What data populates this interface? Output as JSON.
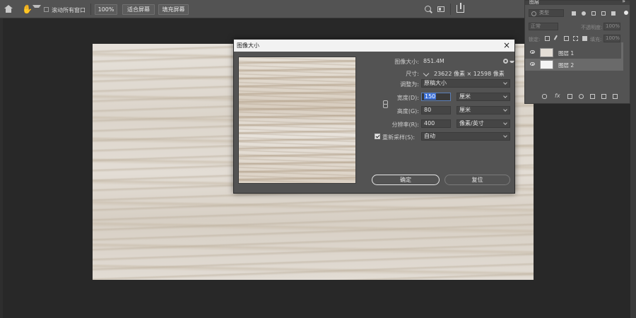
{
  "options_bar": {
    "scroll_all_label": "滚动所有窗口",
    "zoom_value": "100%",
    "fit_screen_label": "适合屏幕",
    "fill_screen_label": "填充屏幕"
  },
  "layers_panel": {
    "title": "图层",
    "menu": "»",
    "filter_placeholder": "类型",
    "blend_mode": "正常",
    "opacity_label": "不透明度:",
    "opacity_value": "100%",
    "lock_label": "锁定:",
    "fill_label": "填充:",
    "fill_value": "100%",
    "layers": [
      {
        "name": "图层 1",
        "selected": false
      },
      {
        "name": "图层 2",
        "selected": true
      }
    ]
  },
  "dialog": {
    "title": "图像大小",
    "close": "×",
    "image_size_label": "图像大小:",
    "image_size_value": "851.4M",
    "dimensions_label": "尺寸:",
    "dimensions_value": "23622 像素  ×  12598 像素",
    "fit_to_label": "调整为:",
    "fit_to_value": "原稿大小",
    "width_label": "宽度(D):",
    "width_value": "150",
    "width_unit": "厘米",
    "height_label": "高度(G):",
    "height_value": "80",
    "height_unit": "厘米",
    "resolution_label": "分辨率(R):",
    "resolution_value": "400",
    "resolution_unit": "像素/英寸",
    "resample_label": "重新采样(S):",
    "resample_checked": true,
    "resample_value": "自动",
    "ok_label": "确定",
    "reset_label": "复位"
  }
}
